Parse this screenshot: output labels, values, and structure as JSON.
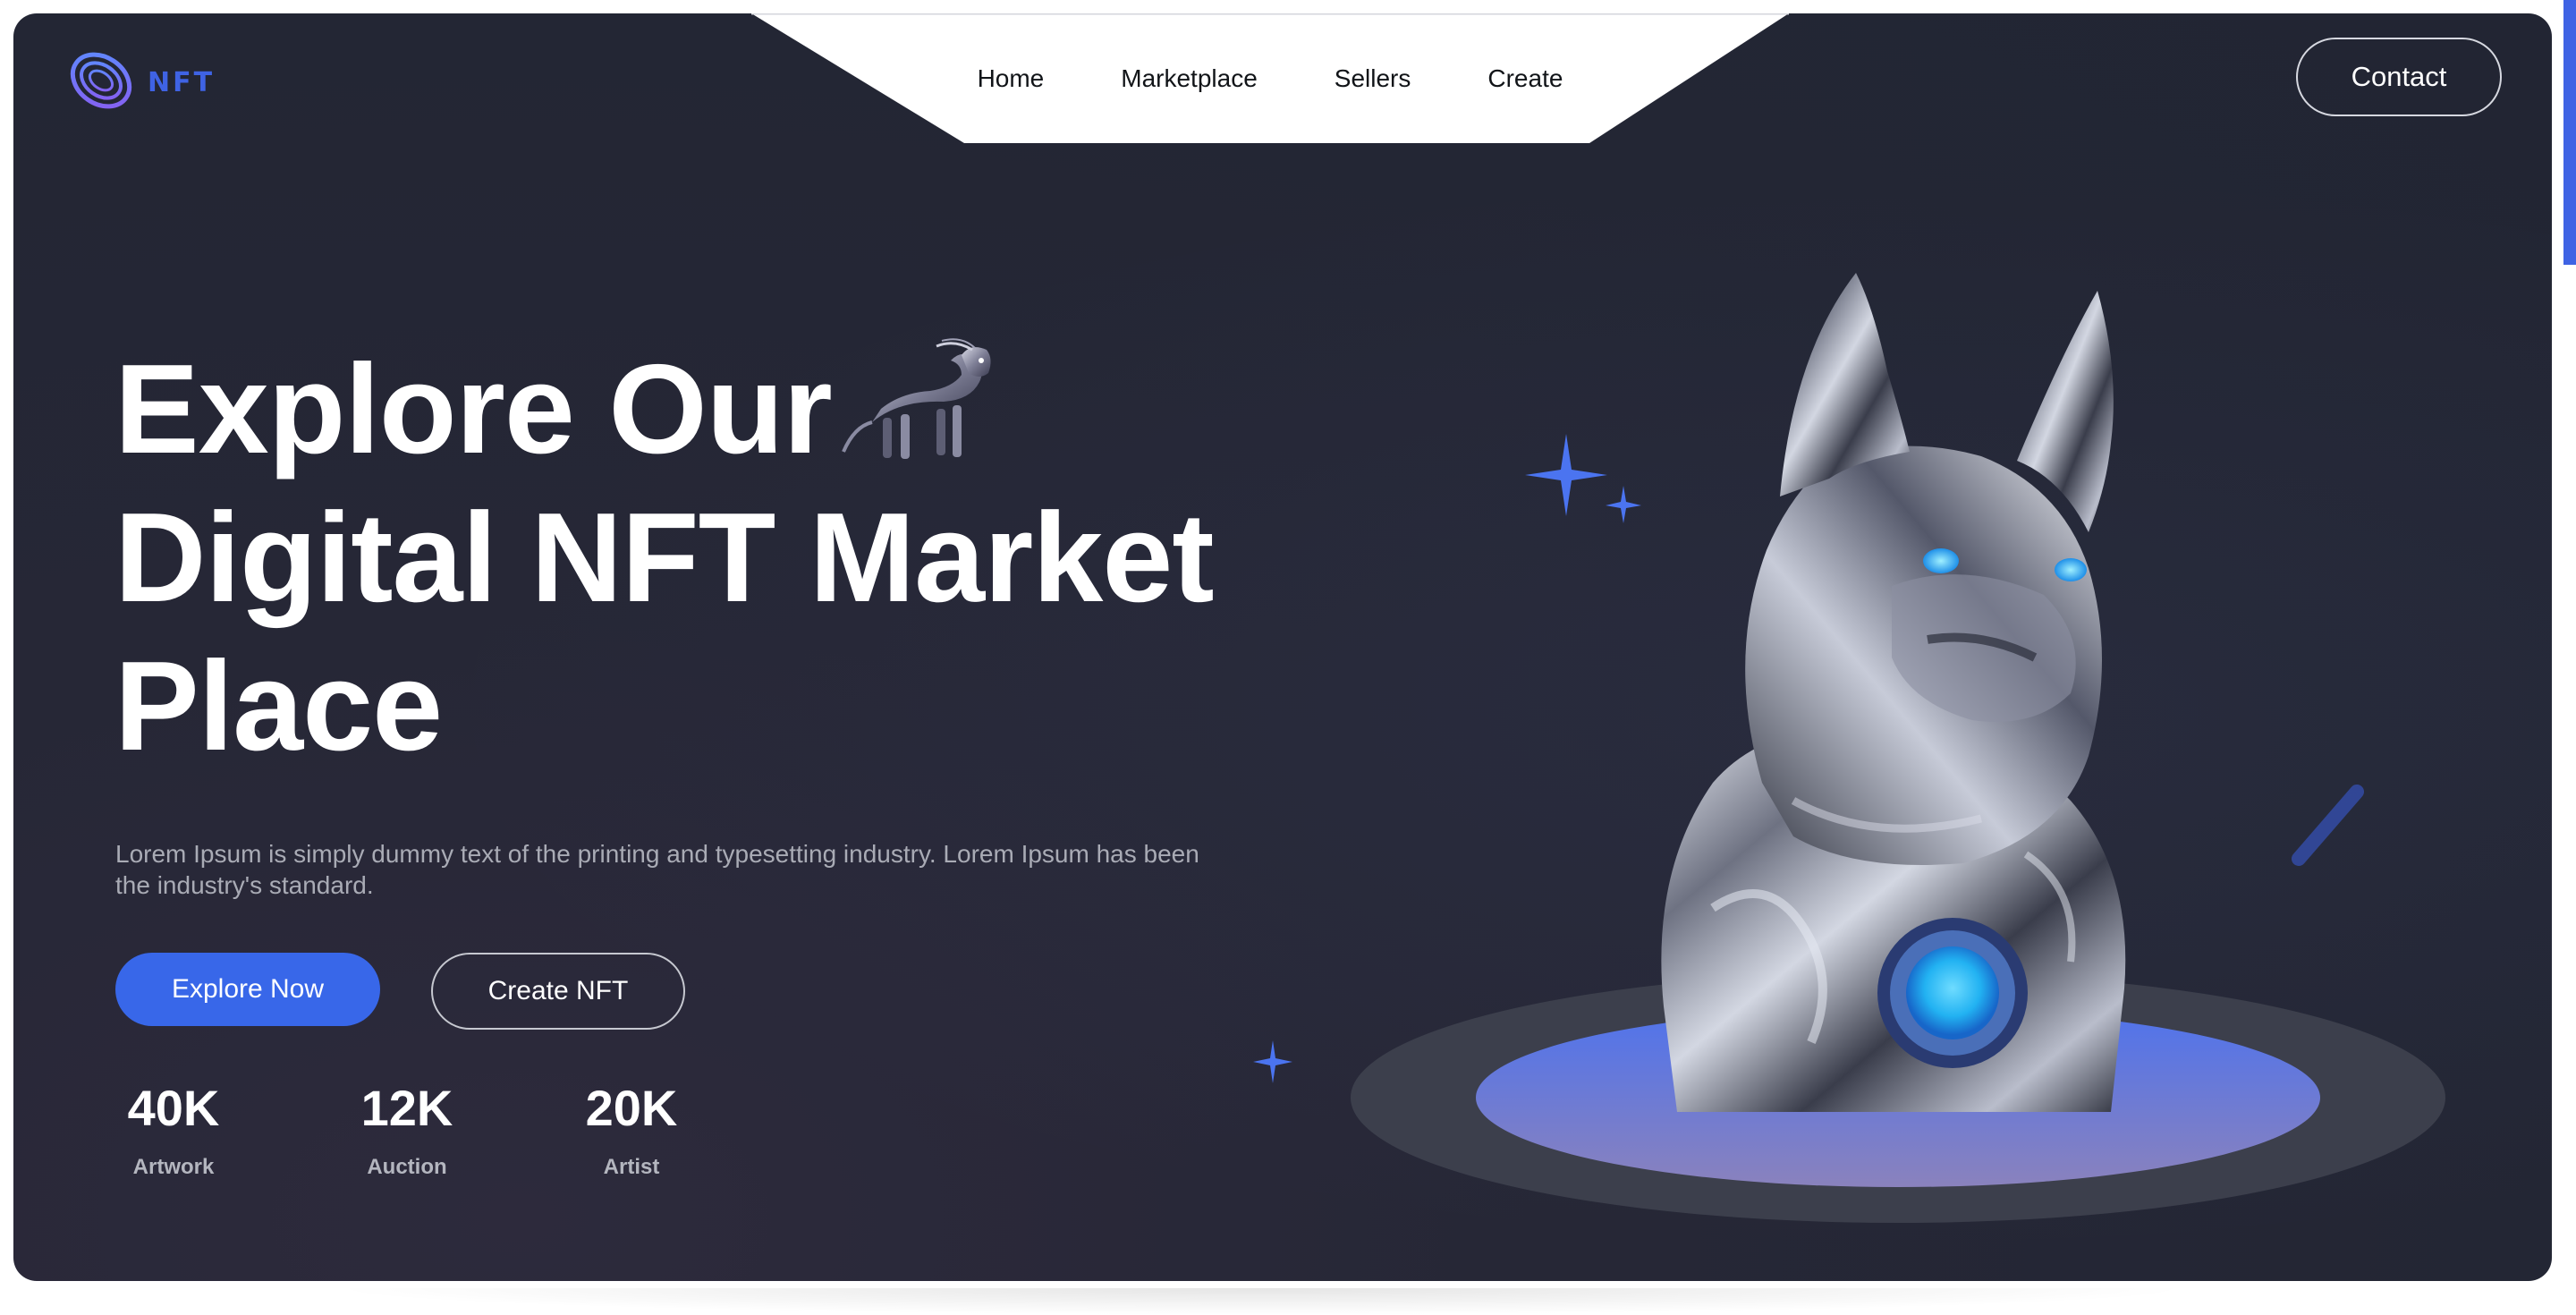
{
  "brand": {
    "name": "NFT",
    "logo_icon": "orbit-rings-logo",
    "accent": "#3867e9"
  },
  "nav": {
    "items": [
      "Home",
      "Marketplace",
      "Sellers",
      "Create"
    ]
  },
  "header": {
    "contact_label": "Contact"
  },
  "hero": {
    "headline_lines": [
      "Explore Our",
      "Digital NFT Market",
      "Place"
    ],
    "description": "Lorem Ipsum is simply dummy text of the printing and typesetting industry. Lorem Ipsum has been the industry's standard.",
    "primary_cta": "Explore Now",
    "secondary_cta": "Create NFT",
    "stats": [
      {
        "value": "40K",
        "label": "Artwork"
      },
      {
        "value": "12K",
        "label": "Auction"
      },
      {
        "value": "20K",
        "label": "Artist"
      }
    ]
  },
  "artwork": {
    "subject": "chrome-dog-bust",
    "gem_color": "#2fb8f5",
    "platform_color": "#5b74e6"
  }
}
